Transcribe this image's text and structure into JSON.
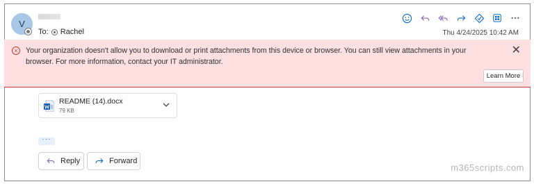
{
  "header": {
    "avatar_initial": "V",
    "to_label": "To:",
    "recipient": "Rachel",
    "timestamp": "Thu 4/24/2025 10:42 AM",
    "actions": [
      {
        "name": "emoji-react",
        "icon": "smiley-icon"
      },
      {
        "name": "reply",
        "icon": "reply-icon"
      },
      {
        "name": "reply-all",
        "icon": "reply-all-icon"
      },
      {
        "name": "forward",
        "icon": "forward-icon"
      },
      {
        "name": "loop",
        "icon": "loop-icon"
      },
      {
        "name": "apps",
        "icon": "apps-icon"
      },
      {
        "name": "more",
        "icon": "more-icon"
      }
    ]
  },
  "banner": {
    "message": "Your organization doesn't allow you to download or print attachments from this device or browser. You can still view attachments in your browser. For more information, contact your IT administrator.",
    "learn_more": "Learn More",
    "colors": {
      "background": "#fde0df",
      "accent": "#c23934"
    }
  },
  "attachment": {
    "name": "README (14).docx",
    "size": "79 KB",
    "icon": "word-doc-icon"
  },
  "more_indicator": "···",
  "buttons": {
    "reply": "Reply",
    "forward": "Forward"
  },
  "watermark": "m365scripts.com",
  "colors": {
    "accent": "#0f6cbd",
    "purple": "#8764b8"
  }
}
